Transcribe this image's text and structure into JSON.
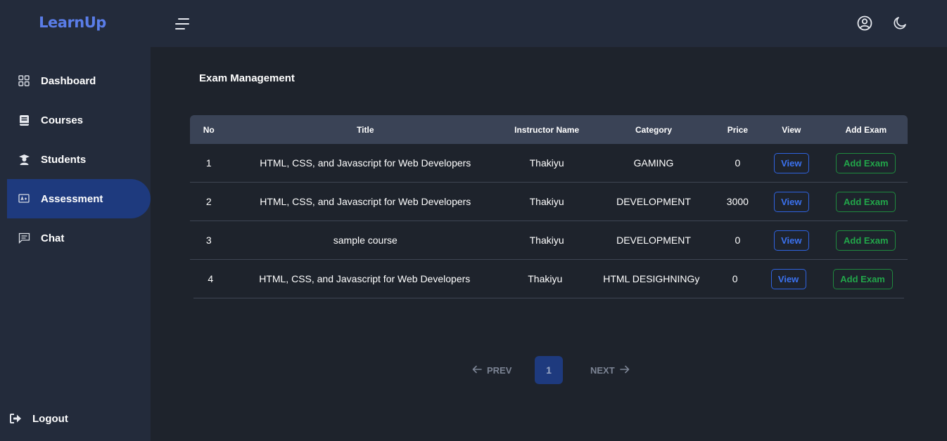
{
  "brand": "LearnUp",
  "sidebar": {
    "items": [
      {
        "label": "Dashboard",
        "icon": "grid-icon"
      },
      {
        "label": "Courses",
        "icon": "book-icon"
      },
      {
        "label": "Students",
        "icon": "graduate-icon"
      },
      {
        "label": "Assessment",
        "icon": "assessment-icon",
        "active": true
      },
      {
        "label": "Chat",
        "icon": "chat-icon"
      }
    ],
    "logout": "Logout"
  },
  "topbar": {
    "menu_icon": "menu-icon",
    "user_icon": "user-circle-icon",
    "theme_icon": "moon-icon"
  },
  "page": {
    "title": "Exam Management"
  },
  "table": {
    "headers": {
      "no": "No",
      "title": "Title",
      "instructor": "Instructor Name",
      "category": "Category",
      "price": "Price",
      "view": "View",
      "add_exam": "Add Exam"
    },
    "rows": [
      {
        "no": "1",
        "title": "HTML, CSS, and Javascript for Web Developers",
        "instructor": "Thakiyu",
        "category": "GAMING",
        "price": "0",
        "view": "View",
        "add": "Add Exam"
      },
      {
        "no": "2",
        "title": "HTML, CSS, and Javascript for Web Developers",
        "instructor": "Thakiyu",
        "category": "DEVELOPMENT",
        "price": "3000",
        "view": "View",
        "add": "Add Exam"
      },
      {
        "no": "3",
        "title": "sample course",
        "instructor": "Thakiyu",
        "category": "DEVELOPMENT",
        "price": "0",
        "view": "View",
        "add": "Add Exam"
      },
      {
        "no": "4",
        "title": "HTML, CSS, and Javascript for Web Developers",
        "instructor": "Thakiyu",
        "category": "HTML DESIGHNINGy",
        "price": "0",
        "view": "View",
        "add": "Add Exam"
      }
    ]
  },
  "pagination": {
    "prev": "PREV",
    "current": "1",
    "next": "NEXT"
  },
  "colors": {
    "accent": "#5a7de8",
    "active_nav": "#1e3a7e",
    "view_button": "#3b72f0",
    "add_button": "#22a64a"
  }
}
